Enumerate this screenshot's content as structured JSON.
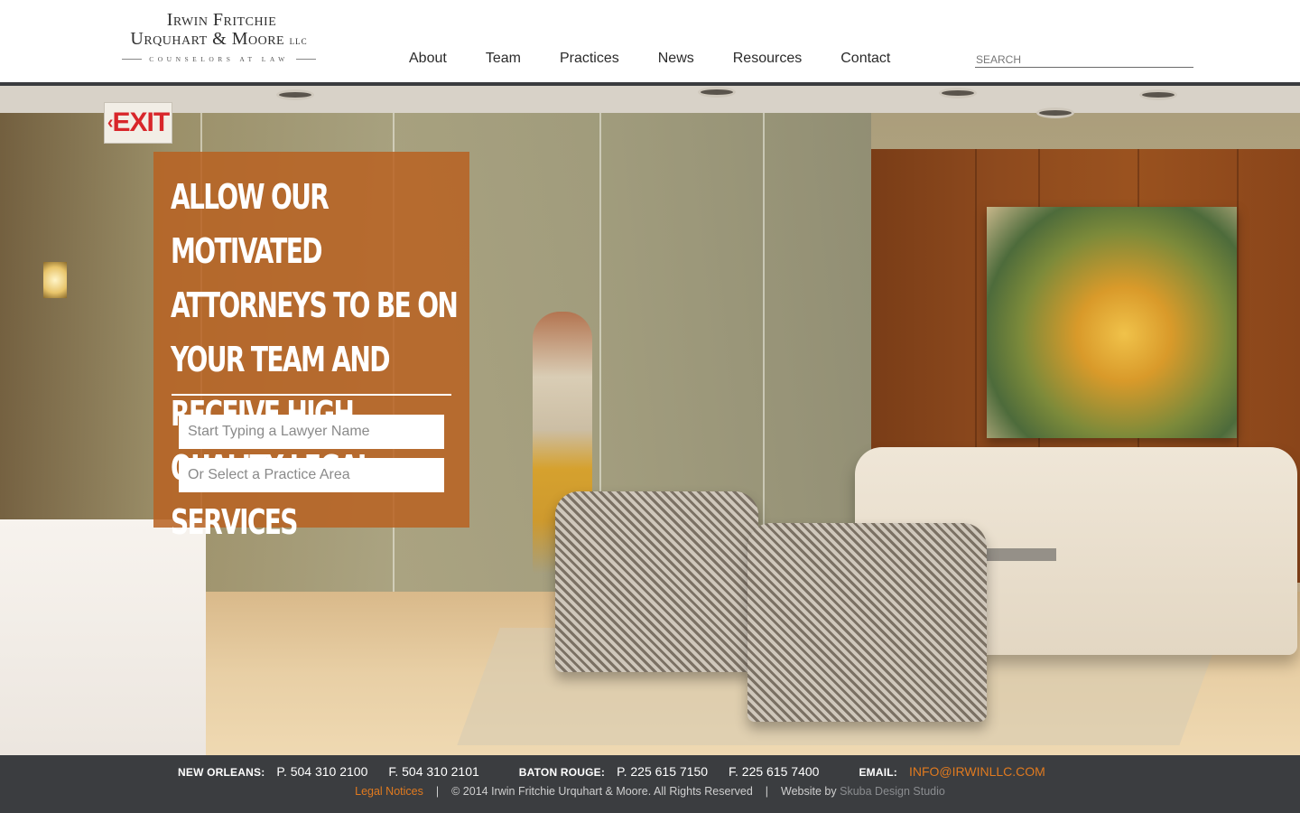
{
  "header": {
    "logo": {
      "line1": "Irwin Fritchie",
      "line2": "Urquhart & Moore",
      "llc": "llc",
      "tagline": "COUNSELORS AT LAW"
    },
    "nav": [
      "About",
      "Team",
      "Practices",
      "News",
      "Resources",
      "Contact"
    ],
    "search_placeholder": "SEARCH"
  },
  "hero": {
    "exit_sign": "EXIT",
    "headline": "Allow our motivated attorneys to be on your team and receive high quality legal services",
    "lawyer_placeholder": "Start Typing a Lawyer Name",
    "practice_placeholder": "Or Select a Practice Area",
    "overlay_color": "#b86222"
  },
  "footer": {
    "new_orleans_label": "NEW ORLEANS:",
    "new_orleans_phone": "P. 504 310 2100",
    "new_orleans_fax": "F. 504 310 2101",
    "baton_rouge_label": "BATON ROUGE:",
    "baton_rouge_phone": "P. 225 615 7150",
    "baton_rouge_fax": "F. 225 615 7400",
    "email_label": "EMAIL:",
    "email": "INFO@IRWINLLC.COM",
    "legal_notices": "Legal Notices",
    "copyright": "© 2014 Irwin Fritchie Urquhart & Moore. All Rights Reserved",
    "website_by": "Website by",
    "designer": "Skuba Design Studio",
    "separator": "|"
  },
  "colors": {
    "accent": "#e07a1f",
    "footer_bg": "#3b3d40",
    "header_rule": "#3a3c3f"
  }
}
